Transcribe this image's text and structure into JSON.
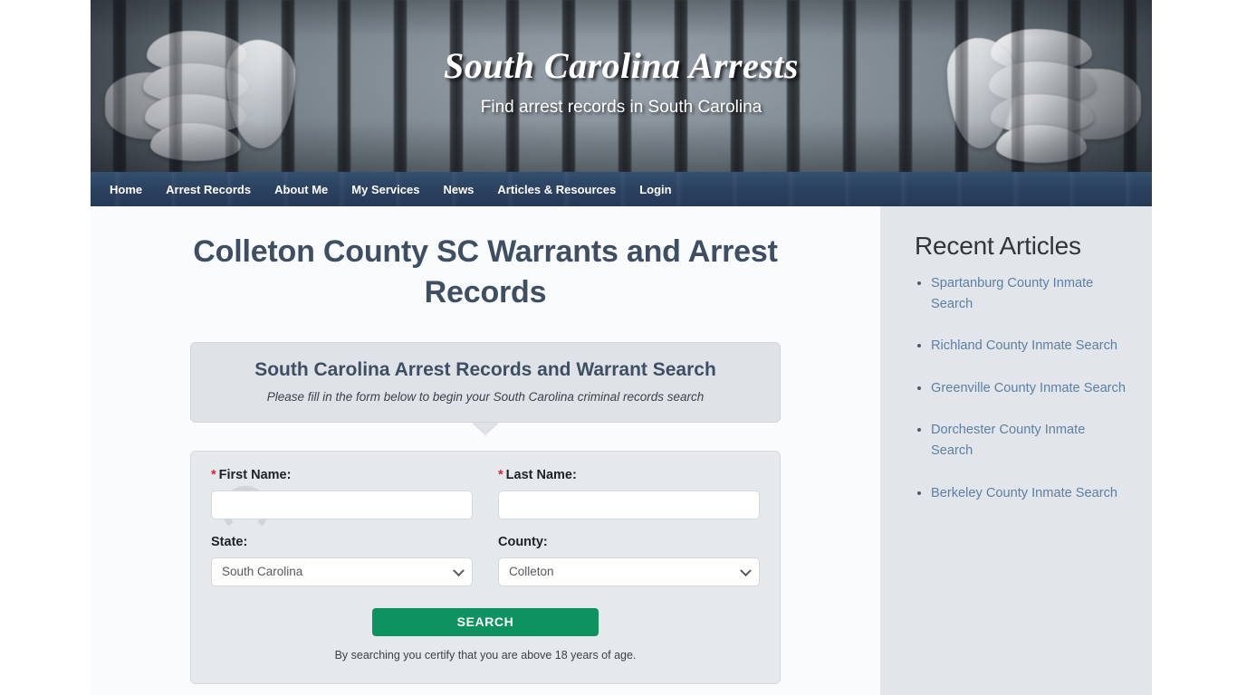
{
  "banner": {
    "title": "South Carolina Arrests",
    "tagline": "Find arrest records in South Carolina"
  },
  "nav": {
    "items": [
      {
        "label": "Home"
      },
      {
        "label": "Arrest Records"
      },
      {
        "label": "About Me"
      },
      {
        "label": "My Services"
      },
      {
        "label": "News"
      },
      {
        "label": "Articles & Resources"
      },
      {
        "label": "Login"
      }
    ]
  },
  "main": {
    "page_title": "Colleton County SC Warrants and Arrest Records",
    "callout": {
      "title": "South Carolina Arrest Records and Warrant Search",
      "subtitle": "Please fill in the form below to begin your South Carolina criminal records search"
    },
    "form": {
      "first_name": {
        "label": "First Name:",
        "required_marker": "*",
        "value": "",
        "placeholder": ""
      },
      "last_name": {
        "label": "Last Name:",
        "required_marker": "*",
        "value": "",
        "placeholder": ""
      },
      "state": {
        "label": "State:",
        "selected": "South Carolina"
      },
      "county": {
        "label": "County:",
        "selected": "Colleton"
      },
      "search_button": "SEARCH",
      "disclaimer": "By searching you certify that you are above 18 years of age."
    }
  },
  "sidebar": {
    "title": "Recent Articles",
    "articles": [
      {
        "label": "Spartanburg County Inmate Search"
      },
      {
        "label": "Richland County Inmate Search"
      },
      {
        "label": "Greenville County Inmate Search"
      },
      {
        "label": "Dorchester County Inmate Search"
      },
      {
        "label": "Berkeley County Inmate Search"
      }
    ]
  },
  "colors": {
    "nav_bg": "#2b4160",
    "heading": "#3e4f63",
    "link": "#5b7fa6",
    "button_green": "#0e9260",
    "required_red": "#d9283c",
    "sidebar_bg": "#e2e6ea",
    "main_bg": "#fafbfc"
  }
}
